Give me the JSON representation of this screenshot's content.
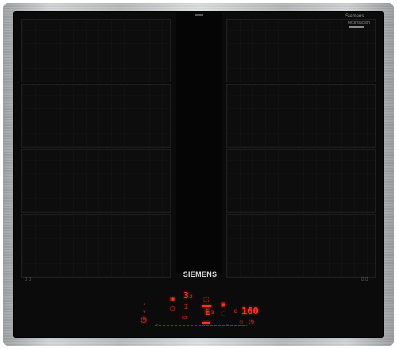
{
  "appliance": {
    "brand": "SIEMENS",
    "badge_top": "Siemens",
    "badge_bottom": "flexInduction"
  },
  "controls": {
    "zone_left_level": "3",
    "zone_left_sub": "2",
    "zone_right_symbol": "E",
    "zone_right_sub": "3",
    "timer": "160",
    "timer_unit": "c",
    "left_corner": "▯ ▯",
    "right_corner": "▯ ▯"
  },
  "colors": {
    "glass": "#0b0b0b",
    "display_red": "#ff3322",
    "frame": "#c8cacb"
  }
}
